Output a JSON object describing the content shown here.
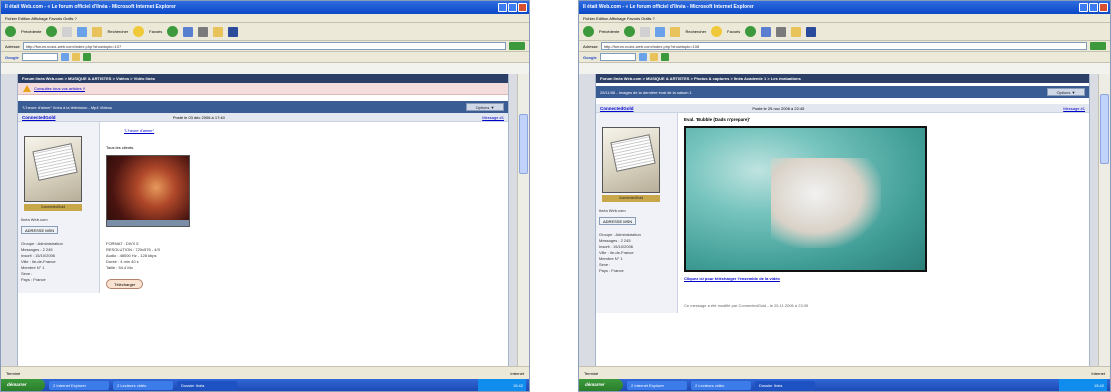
{
  "left": {
    "title": "Il était Web.com - « Le forum officiel d'Ilnéa - Microsoft Internet Explorer",
    "menu": "Fichier   Edition   Affichage   Favoris   Outils   ?",
    "toolbar": {
      "back": "Précédente",
      "search": "Rechercher",
      "favorites": "Favoris"
    },
    "address": {
      "label": "Adresse",
      "value": "http://forum.noziz-web.com/index.php?showtopic=107"
    },
    "google": "Google",
    "nav": "Forum Ilnéa Web.com > MUSIQUE & ARTISTES > Vidéos > Vidéo Ilnéa",
    "notice": "Consultez tous vos articles !!",
    "topic": {
      "title": "\"L'heure d'aimer\" Ilnéa à la télévision - Mp4 Videos",
      "options": "Options ▼"
    },
    "post": {
      "author": "ConnectedGold",
      "date": "Posté le 03 déc 2006 à 17:40",
      "number": "Message #1",
      "quote_title": "\"L'heure d'aimer\"",
      "text": "Tous les clients.",
      "video_info": [
        "FORMAT : DIVX 5",
        "RESOLUTION : 720x576 - 4/3",
        "Audio : 48000 Hz - 128 kbps",
        "Durée : 4 min 40 s",
        "Taille : 54,4 Mo"
      ],
      "download_btn": "Télécharger"
    },
    "author_info": {
      "caption": "ConnectedGold",
      "member": "Ilnéa Web.com",
      "msn_btn": "ADRESSE MSN",
      "lines": [
        "Groupe : Administration",
        "Messages : 2 245",
        "Inscrit : 15/10/2006",
        "Ville : Ile-de-France",
        "Membre N° 1",
        "Sexe :",
        "Pays : France"
      ]
    },
    "status": {
      "text": "Terminé",
      "zone": "Internet"
    },
    "tasks": [
      "2 Internet Explorer",
      "2 Lecteurs vidéo",
      "Dossier Ilnéa"
    ]
  },
  "right": {
    "title": "Il était Web.com - « Le forum officiel d'Ilnéa - Microsoft Internet Explorer",
    "menu": "Fichier   Edition   Affichage   Favoris   Outils   ?",
    "address": {
      "label": "Adresse",
      "value": "http://forum.noziz-web.com/index.php?showtopic=108"
    },
    "google": "Google",
    "nav": "Forum Ilnéa Web.com > MUSIQUE & ARTISTES > Photos & captures > Ilnéa Academie 1 > Les évaluations",
    "topic": {
      "title": "25/11/06 - Images de la dernière éval de la saison 1",
      "options": "Options ▼"
    },
    "post": {
      "author": "ConnectedGold",
      "date": "Posté le 25 nov 2006 à 22:45",
      "number": "Message #1",
      "heading": "Eval. 'Bubble (Dads n'prepare)'",
      "link": "Cliquez ici pour télécharger l'ensemble de la vidéo",
      "edit_note": "Ce message a été modifié par ConnectedGold - le 25.11.2006 à 23:35"
    },
    "author_info": {
      "caption": "ConnectedGold",
      "member": "Ilnéa Web.com",
      "msn_btn": "ADRESSE MSN",
      "lines": [
        "Groupe : Administration",
        "Messages : 2 245",
        "Inscrit : 15/10/2006",
        "Ville : Ile-de-France",
        "Membre N° 1",
        "Sexe :",
        "Pays : France"
      ]
    },
    "status": {
      "text": "Terminé",
      "zone": "Internet"
    },
    "tasks": [
      "2 Internet Explorer",
      "2 Lecteurs vidéo",
      "Dossier Ilnéa"
    ]
  },
  "start_label": "démarrer",
  "clock": "15:42",
  "colors": {
    "xp_blue": "#0a48c8",
    "forum_header": "#3a5c95",
    "notice_bg": "#f3dcdc",
    "start_green": "#3c9a3c"
  }
}
